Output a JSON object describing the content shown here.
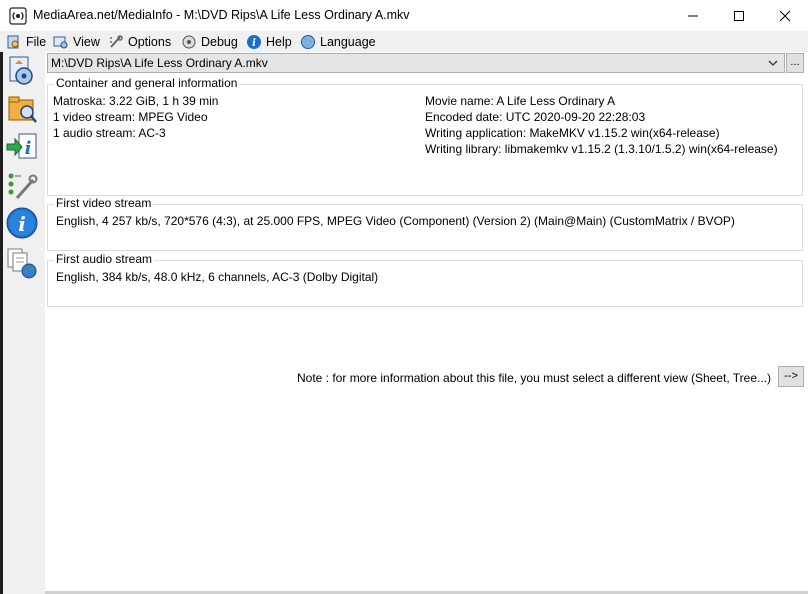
{
  "window": {
    "title": "MediaArea.net/MediaInfo - M:\\DVD Rips\\A Life Less Ordinary A.mkv"
  },
  "menu": [
    {
      "label": "File",
      "icon": "file-icon"
    },
    {
      "label": "View",
      "icon": "view-icon"
    },
    {
      "label": "Options",
      "icon": "options-icon"
    },
    {
      "label": "Debug",
      "icon": "debug-icon"
    },
    {
      "label": "Help",
      "icon": "help-icon"
    },
    {
      "label": "Language",
      "icon": "language-icon"
    }
  ],
  "file_selector": {
    "value": "M:\\DVD Rips\\A Life Less Ordinary A.mkv",
    "browse_label": "..."
  },
  "general": {
    "legend": "Container and general information",
    "left": [
      "Matroska: 3.22 GiB, 1 h 39 min",
      "1 video stream: MPEG Video",
      "1 audio stream: AC-3"
    ],
    "right": [
      "Movie name: A Life Less Ordinary A",
      "Encoded date: UTC 2020-09-20 22:28:03",
      "Writing application: MakeMKV v1.15.2 win(x64-release)",
      "Writing library: libmakemkv v1.15.2 (1.3.10/1.5.2) win(x64-release)"
    ]
  },
  "video": {
    "legend": "First video stream",
    "text": "English, 4 257 kb/s, 720*576 (4:3), at 25.000 FPS, MPEG Video (Component) (Version 2) (Main@Main) (CustomMatrix / BVOP)"
  },
  "audio": {
    "legend": "First audio stream",
    "text": "English, 384 kb/s, 48.0 kHz, 6 channels, AC-3 (Dolby Digital)"
  },
  "note": {
    "text": "Note : for more information about this file, you must select a different view (Sheet, Tree...)",
    "button_label": "-->"
  },
  "colors": {
    "accent_blue": "#1b6fc9",
    "bar_bg": "#f0f0f0"
  }
}
